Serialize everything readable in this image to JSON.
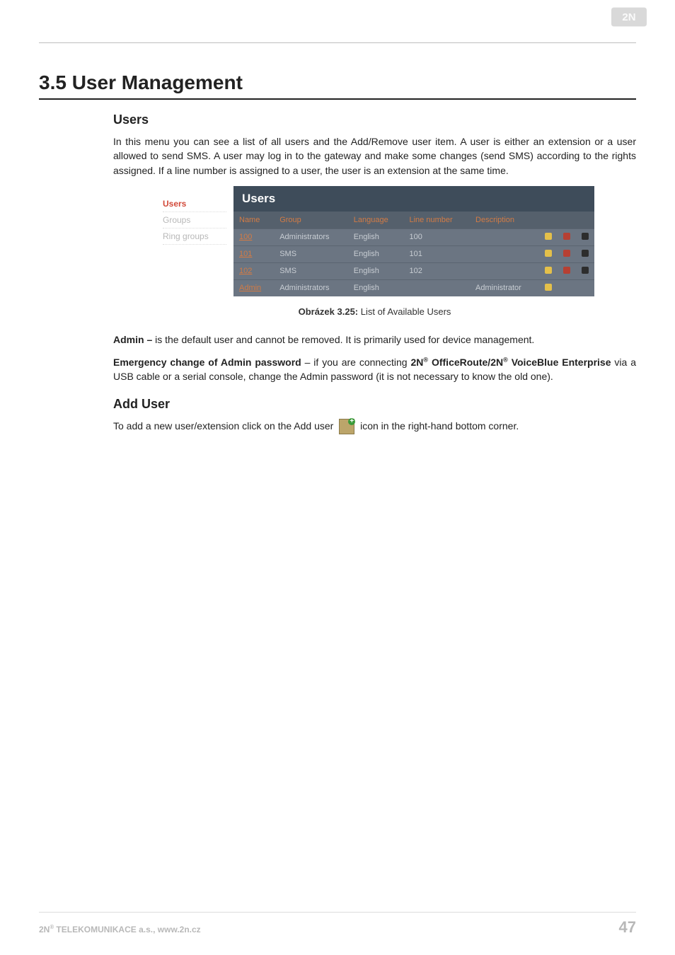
{
  "logo_text": "2N",
  "section_title": "3.5 User Management",
  "users_heading": "Users",
  "users_para": "In this menu you can see a list of all users and the Add/Remove user item. A user is either an extension or a user allowed to send SMS. A user may log in to the gateway and make some changes (send SMS) according to the rights assigned. If a line number is assigned to a user, the user is an extension at the same time.",
  "figure": {
    "sidebar": {
      "items": [
        "Users",
        "Groups",
        "Ring groups"
      ]
    },
    "title": "Users",
    "columns": [
      "Name",
      "Group",
      "Language",
      "Line number",
      "Description"
    ],
    "rows": [
      {
        "name": "100",
        "group": "Administrators",
        "language": "English",
        "line": "100",
        "desc": ""
      },
      {
        "name": "101",
        "group": "SMS",
        "language": "English",
        "line": "101",
        "desc": ""
      },
      {
        "name": "102",
        "group": "SMS",
        "language": "English",
        "line": "102",
        "desc": ""
      },
      {
        "name": "Admin",
        "group": "Administrators",
        "language": "English",
        "line": "",
        "desc": "Administrator"
      }
    ]
  },
  "caption_label": "Obrázek 3.25:",
  "caption_text": " List of Available Users",
  "admin_bold": "Admin –",
  "admin_text": " is the default user and cannot be removed. It is primarily used for device management.",
  "emerg_bold": "Emergency change of Admin password",
  "emerg_mid": " – if you are connecting ",
  "prod1_bold": "2N",
  "prod_sup": "®",
  "prod_space": " ",
  "prod2_bold": "OfficeRoute/2N",
  "prod3_bold": " VoiceBlue Enterprise",
  "emerg_tail": " via a USB cable or a serial console, change the Admin password (it is not necessary to know the old one).",
  "add_user_heading": "Add User",
  "add_user_pre": "To add a new user/extension click on the Add user ",
  "add_user_post": " icon in the right-hand bottom corner.",
  "footer_left_pre": "2N",
  "footer_left_sup": "®",
  "footer_left_post": " TELEKOMUNIKACE a.s., www.2n.cz",
  "page_number": "47"
}
